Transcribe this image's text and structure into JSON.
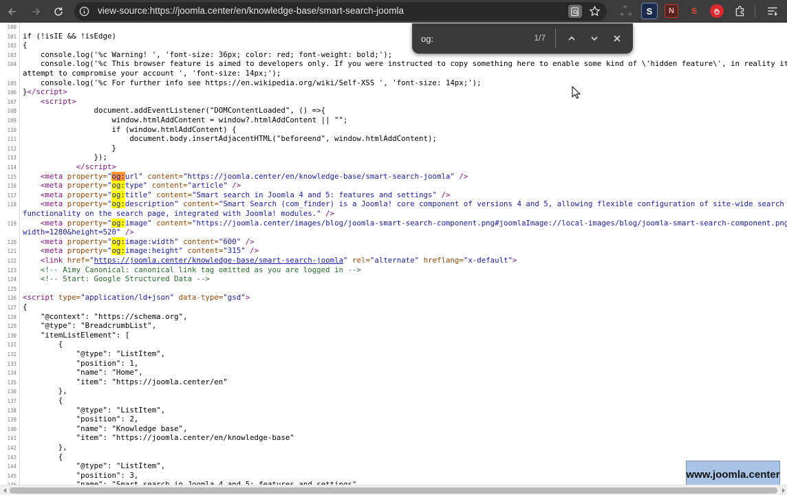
{
  "browser": {
    "url": "view-source:https://joomla.center/en/knowledge-base/smart-search-joomla",
    "extensions": [
      {
        "name": "tool-icon",
        "letter": "",
        "color": "#3c3c3c"
      },
      {
        "name": "s-extension-icon",
        "letter": "S",
        "color": "#4d6fae"
      },
      {
        "name": "n-extension-icon",
        "letter": "N",
        "color": "#a43a2c"
      },
      {
        "name": "seo-extension-icon",
        "letter": "S",
        "color": "#c23a2a"
      },
      {
        "name": "stop-extension-icon",
        "letter": "",
        "color": "#d92b2b"
      }
    ]
  },
  "find_bar": {
    "query": "og:",
    "count": "1/7"
  },
  "source_lines": [
    {
      "n": "100",
      "html": ""
    },
    {
      "n": "101",
      "html": "if (!isIE &amp;&amp; !isEdge)"
    },
    {
      "n": "102",
      "html": "{"
    },
    {
      "n": "103",
      "html": "    console.log('%c Warning! ', 'font-size: 36px; color: red; font-weight: bold;');"
    },
    {
      "n": "104",
      "html": "    console.log('%c This browser feature is aimed to developers only. If you were instructed to copy something here to enable some kind of \\'hidden feature\\', in reality it is a scam attempt"
    },
    {
      "n": "",
      "html": "attempt to compromise your account ', 'font-size: 14px;');"
    },
    {
      "n": "105",
      "html": "    console.log('%c For further info see https://en.wikipedia.org/wiki/Self-XSS ', 'font-size: 14px;');"
    },
    {
      "n": "106",
      "html": "}<span class=\"tag\">&lt;/script&gt;</span>"
    },
    {
      "n": "107",
      "html": "    <span class=\"tag\">&lt;script&gt;</span>"
    },
    {
      "n": "108",
      "html": "                document.addEventListener(\"DOMContentLoaded\", () =&gt;{"
    },
    {
      "n": "109",
      "html": "                    window.htmlAddContent = window?.htmlAddContent || \"\";"
    },
    {
      "n": "110",
      "html": "                    if (window.htmlAddContent) {"
    },
    {
      "n": "111",
      "html": "                        document.body.insertAdjacentHTML(\"beforeend\", window.htmlAddContent);"
    },
    {
      "n": "112",
      "html": "                    }"
    },
    {
      "n": "113",
      "html": "                });"
    },
    {
      "n": "114",
      "html": "            <span class=\"tag\">&lt;/script&gt;</span>"
    },
    {
      "n": "115",
      "html": "    <span class=\"tag\">&lt;meta</span> <span class=\"attr\">property=</span><span class=\"val\">\"<span class=\"hlc\">og:</span>url\"</span> <span class=\"attr\">content=</span><span class=\"val\">\"https://joomla.center/en/knowledge-base/smart-search-joomla\"</span> <span class=\"tag\">/&gt;</span>"
    },
    {
      "n": "116",
      "html": "    <span class=\"tag\">&lt;meta</span> <span class=\"attr\">property=</span><span class=\"val\">\"<span class=\"hl\">og:</span>type\"</span> <span class=\"attr\">content=</span><span class=\"val\">\"article\"</span> <span class=\"tag\">/&gt;</span>"
    },
    {
      "n": "117",
      "html": "    <span class=\"tag\">&lt;meta</span> <span class=\"attr\">property=</span><span class=\"val\">\"<span class=\"hl\">og:</span>title\"</span> <span class=\"attr\">content=</span><span class=\"val\">\"Smart search in Joomla 4 and 5: features and settings\"</span> <span class=\"tag\">/&gt;</span>"
    },
    {
      "n": "118",
      "html": "    <span class=\"tag\">&lt;meta</span> <span class=\"attr\">property=</span><span class=\"val\">\"<span class=\"hl\">og:</span>description\"</span> <span class=\"attr\">content=</span><span class=\"val\">\"Smart Search (com_finder) is a Joomla! core component of versions 4 and 5, allowing flexible configuration of site-wide search and</span>"
    },
    {
      "n": "",
      "html": "<span class=\"val\">functionality on the search page, integrated with Joomla! modules.\"</span> <span class=\"tag\">/&gt;</span>"
    },
    {
      "n": "119",
      "html": "    <span class=\"tag\">&lt;meta</span> <span class=\"attr\">property=</span><span class=\"val\">\"<span class=\"hl\">og:</span>image\"</span> <span class=\"attr\">content=</span><span class=\"val\">\"https://joomla.center/images/blog/joomla-smart-search-component.png#joomlaImage://local-images/blog/joomla-smart-search-component.png?</span>"
    },
    {
      "n": "",
      "html": "<span class=\"val\">width=1280&amp;height=520\"</span> <span class=\"tag\">/&gt;</span>"
    },
    {
      "n": "120",
      "html": "    <span class=\"tag\">&lt;meta</span> <span class=\"attr\">property=</span><span class=\"val\">\"<span class=\"hl\">og:</span>image:width\"</span> <span class=\"attr\">content=</span><span class=\"val\">\"600\"</span> <span class=\"tag\">/&gt;</span>"
    },
    {
      "n": "121",
      "html": "    <span class=\"tag\">&lt;meta</span> <span class=\"attr\">property=</span><span class=\"val\">\"<span class=\"hl\">og:</span>image:height\"</span> <span class=\"attr\">content=</span><span class=\"val\">\"315\"</span> <span class=\"tag\">/&gt;</span>"
    },
    {
      "n": "122",
      "html": "    <span class=\"tag\">&lt;link</span> <span class=\"attr\">href=</span><span class=\"val\">\"<span class=\"lnk\">https://joomla.center/knowledge-base/smart-search-joomla</span>\"</span> <span class=\"attr\">rel=</span><span class=\"val\">\"alternate\"</span> <span class=\"attr\">hreflang=</span><span class=\"val\">\"x-default\"</span><span class=\"tag\">&gt;</span>"
    },
    {
      "n": "123",
      "html": "    <span class=\"cmt\">&lt;!-- Aimy Canonical: canonical link tag omitted as you are logged in --&gt;</span>"
    },
    {
      "n": "124",
      "html": "    <span class=\"cmt\">&lt;!-- Start: Google Structured Data --&gt;</span>"
    },
    {
      "n": "125",
      "html": ""
    },
    {
      "n": "126",
      "html": "<span class=\"tag\">&lt;script</span> <span class=\"attr\">type=</span><span class=\"val\">\"application/ld+json\"</span> <span class=\"attr\">data-type=</span><span class=\"val\">\"gsd\"</span><span class=\"tag\">&gt;</span>"
    },
    {
      "n": "127",
      "html": "{"
    },
    {
      "n": "128",
      "html": "    \"@context\": \"https://schema.org\","
    },
    {
      "n": "129",
      "html": "    \"@type\": \"BreadcrumbList\","
    },
    {
      "n": "130",
      "html": "    \"itemListElement\": ["
    },
    {
      "n": "131",
      "html": "        {"
    },
    {
      "n": "132",
      "html": "            \"@type\": \"ListItem\","
    },
    {
      "n": "133",
      "html": "            \"position\": 1,"
    },
    {
      "n": "134",
      "html": "            \"name\": \"Home\","
    },
    {
      "n": "135",
      "html": "            \"item\": \"https://joomla.center/en\""
    },
    {
      "n": "136",
      "html": "        },"
    },
    {
      "n": "137",
      "html": "        {"
    },
    {
      "n": "138",
      "html": "            \"@type\": \"ListItem\","
    },
    {
      "n": "139",
      "html": "            \"position\": 2,"
    },
    {
      "n": "140",
      "html": "            \"name\": \"Knowledge base\","
    },
    {
      "n": "141",
      "html": "            \"item\": \"https://joomla.center/en/knowledge-base\""
    },
    {
      "n": "142",
      "html": "        },"
    },
    {
      "n": "143",
      "html": "        {"
    },
    {
      "n": "144",
      "html": "            \"@type\": \"ListItem\","
    },
    {
      "n": "145",
      "html": "            \"position\": 3,"
    },
    {
      "n": "146",
      "html": "            \"name\": \"Smart search in Joomla 4 and 5: features and settings\","
    }
  ],
  "watermark": "www.joomla.center"
}
